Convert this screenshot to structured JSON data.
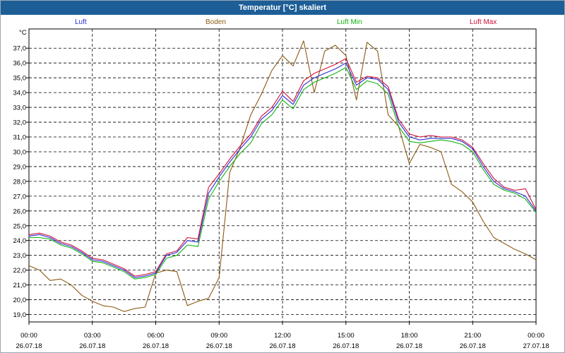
{
  "title": "Temperatur [°C] skaliert",
  "unit": "°C",
  "colors": {
    "titlebar": "#1d5e97",
    "luft": "#2b2bd6",
    "boden": "#8b5a14",
    "luft_min": "#13b113",
    "luft_max": "#d0103a"
  },
  "chart_data": {
    "type": "line",
    "ylabel": "°C",
    "ylim": [
      18.5,
      38.3
    ],
    "xlim": [
      0,
      24
    ],
    "grid": true,
    "legend_placement": "top",
    "y_ticks": [
      19.0,
      20.0,
      21.0,
      22.0,
      23.0,
      24.0,
      25.0,
      26.0,
      27.0,
      28.0,
      29.0,
      30.0,
      31.0,
      32.0,
      33.0,
      34.0,
      35.0,
      36.0,
      37.0
    ],
    "y_tick_labels": [
      "19,0",
      "20,0",
      "21,0",
      "22,0",
      "23,0",
      "24,0",
      "25,0",
      "26,0",
      "27,0",
      "28,0",
      "29,0",
      "30,0",
      "31,0",
      "32,0",
      "33,0",
      "34,0",
      "35,0",
      "36,0",
      "37,0"
    ],
    "x_ticks": [
      0,
      3,
      6,
      9,
      12,
      15,
      18,
      21,
      24
    ],
    "x_tick_times": [
      "00:00",
      "03:00",
      "06:00",
      "09:00",
      "12:00",
      "15:00",
      "18:00",
      "21:00",
      "00:00"
    ],
    "x_tick_dates": [
      "26.07.18",
      "26.07.18",
      "26.07.18",
      "26.07.18",
      "26.07.18",
      "26.07.18",
      "26.07.18",
      "26.07.18",
      "27.07.18"
    ],
    "series": [
      {
        "name": "Luft",
        "color": "#2b2bd6",
        "x": [
          0,
          0.5,
          1,
          1.5,
          2,
          2.5,
          3,
          3.5,
          4,
          4.5,
          5,
          5.5,
          6,
          6.5,
          7,
          7.5,
          8,
          8.5,
          9,
          9.5,
          10,
          10.5,
          11,
          11.5,
          12,
          12.5,
          13,
          13.5,
          14,
          14.5,
          15,
          15.5,
          16,
          16.5,
          17,
          17.5,
          18,
          18.5,
          19,
          19.5,
          20,
          20.5,
          21,
          21.5,
          22,
          22.5,
          23,
          23.5,
          24
        ],
        "y": [
          24.3,
          24.4,
          24.2,
          23.8,
          23.6,
          23.2,
          22.7,
          22.6,
          22.3,
          22.0,
          21.5,
          21.6,
          21.8,
          23.0,
          23.2,
          24.0,
          23.9,
          27.2,
          28.3,
          29.3,
          30.2,
          31.0,
          32.2,
          32.8,
          33.8,
          33.2,
          34.5,
          35.0,
          35.3,
          35.6,
          36.0,
          34.5,
          35.0,
          34.9,
          34.2,
          32.0,
          31.0,
          30.8,
          30.9,
          30.9,
          30.9,
          30.7,
          30.2,
          29.0,
          28.0,
          27.5,
          27.3,
          27.0,
          26.0
        ]
      },
      {
        "name": "Boden",
        "color": "#8b5a14",
        "x": [
          0,
          0.5,
          1,
          1.5,
          2,
          2.5,
          3,
          3.5,
          4,
          4.5,
          5,
          5.5,
          6,
          6.5,
          7,
          7.5,
          8,
          8.5,
          9,
          9.5,
          10,
          10.5,
          11,
          11.5,
          12,
          12.5,
          13,
          13.5,
          14,
          14.5,
          15,
          15.5,
          16,
          16.5,
          17,
          17.5,
          18,
          18.5,
          19,
          19.5,
          20,
          20.5,
          21,
          21.5,
          22,
          22.5,
          23,
          23.5,
          24
        ],
        "y": [
          22.3,
          22.0,
          21.3,
          21.4,
          21.0,
          20.3,
          19.9,
          19.6,
          19.5,
          19.2,
          19.4,
          19.5,
          21.8,
          22.0,
          21.9,
          19.6,
          19.9,
          20.1,
          21.5,
          28.6,
          30.3,
          32.5,
          33.9,
          35.5,
          36.5,
          35.8,
          37.5,
          34.0,
          36.8,
          37.2,
          36.5,
          33.5,
          37.4,
          36.8,
          32.5,
          31.7,
          29.2,
          30.5,
          30.3,
          30.0,
          27.8,
          27.3,
          26.6,
          25.3,
          24.2,
          23.8,
          23.4,
          23.1,
          22.7
        ]
      },
      {
        "name": "Luft Min",
        "color": "#13b113",
        "x": [
          0,
          0.5,
          1,
          1.5,
          2,
          2.5,
          3,
          3.5,
          4,
          4.5,
          5,
          5.5,
          6,
          6.5,
          7,
          7.5,
          8,
          8.5,
          9,
          9.5,
          10,
          10.5,
          11,
          11.5,
          12,
          12.5,
          13,
          13.5,
          14,
          14.5,
          15,
          15.5,
          16,
          16.5,
          17,
          17.5,
          18,
          18.5,
          19,
          19.5,
          20,
          20.5,
          21,
          21.5,
          22,
          22.5,
          23,
          23.5,
          24
        ],
        "y": [
          24.2,
          24.2,
          24.1,
          23.7,
          23.5,
          23.1,
          22.6,
          22.5,
          22.2,
          21.9,
          21.4,
          21.5,
          21.7,
          22.8,
          23.0,
          23.7,
          23.6,
          26.8,
          28.0,
          29.0,
          29.9,
          30.6,
          31.9,
          32.5,
          33.5,
          32.9,
          34.2,
          34.7,
          35.0,
          35.3,
          35.7,
          34.2,
          34.8,
          34.6,
          33.9,
          31.7,
          30.7,
          30.6,
          30.7,
          30.8,
          30.7,
          30.5,
          30.0,
          28.8,
          27.8,
          27.4,
          27.2,
          26.8,
          25.9
        ]
      },
      {
        "name": "Luft Max",
        "color": "#d0103a",
        "x": [
          0,
          0.5,
          1,
          1.5,
          2,
          2.5,
          3,
          3.5,
          4,
          4.5,
          5,
          5.5,
          6,
          6.5,
          7,
          7.5,
          8,
          8.5,
          9,
          9.5,
          10,
          10.5,
          11,
          11.5,
          12,
          12.5,
          13,
          13.5,
          14,
          14.5,
          15,
          15.5,
          16,
          16.5,
          17,
          17.5,
          18,
          18.5,
          19,
          19.5,
          20,
          20.5,
          21,
          21.5,
          22,
          22.5,
          23,
          23.5,
          24
        ],
        "y": [
          24.4,
          24.5,
          24.3,
          23.9,
          23.7,
          23.3,
          22.8,
          22.7,
          22.4,
          22.1,
          21.6,
          21.7,
          21.9,
          23.1,
          23.3,
          24.2,
          24.1,
          27.6,
          28.5,
          29.5,
          30.4,
          31.2,
          32.4,
          33.0,
          34.1,
          33.4,
          34.8,
          35.3,
          35.6,
          35.9,
          36.3,
          34.7,
          35.1,
          35.0,
          34.4,
          32.2,
          31.2,
          31.0,
          31.1,
          31.0,
          31.0,
          30.8,
          30.3,
          29.2,
          28.2,
          27.6,
          27.4,
          27.5,
          26.1
        ]
      }
    ]
  }
}
